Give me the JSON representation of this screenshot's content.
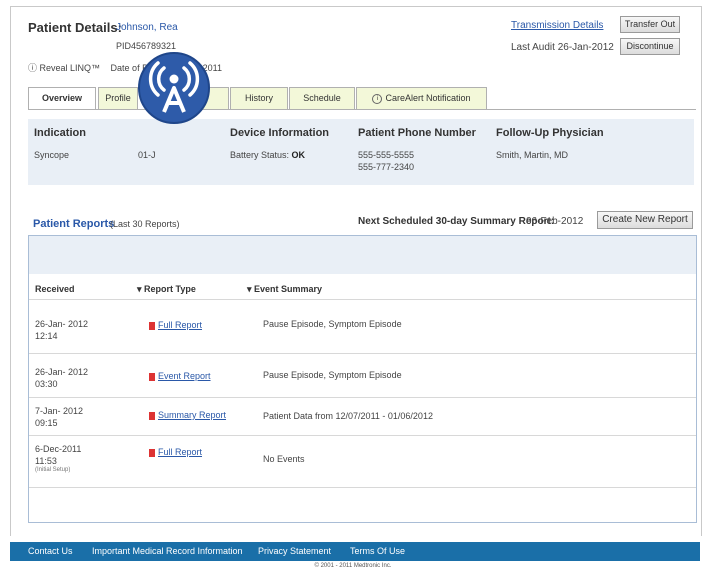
{
  "header": {
    "label": "Patient Details:",
    "patient_name": "Johnson, Rea",
    "patient_id": "PID456789321",
    "device": "ⓘ Reveal LINQ™",
    "dob_label": "Date of B",
    "dob_value": "2011",
    "transmission_link": "Transmission Details",
    "last_audit": "Last Audit  26-Jan-2012",
    "transfer_btn": "Transfer Out",
    "discontinue_btn": "Discontinue"
  },
  "tabs": [
    {
      "label": "Overview"
    },
    {
      "label": "Profile"
    },
    {
      "label": ""
    },
    {
      "label": "History"
    },
    {
      "label": "Schedule"
    },
    {
      "label": "CareAlert Notification"
    }
  ],
  "info": {
    "indication_head": "Indication",
    "indication_val": "Syncope",
    "date_val": "01-J",
    "device_head": "Device Information",
    "battery_label": "Battery Status:",
    "battery_val": "OK",
    "phone_head": "Patient Phone Number",
    "phone1": "555-555-5555",
    "phone2": "555-777-2340",
    "physician_head": "Follow-Up Physician",
    "physician_val": "Smith, Martin, MD"
  },
  "badge": {
    "icon": "broadcast-a-icon",
    "color": "#2e5ba9"
  },
  "reports": {
    "title": "Patient Reports",
    "subtitle": "(Last 30 Reports)",
    "next_label": "Next Scheduled 30-day Summary Report:",
    "next_value": "06-Feb-2012",
    "create_btn": "Create New Report",
    "columns": [
      "Received",
      "Report Type",
      "Event Summary"
    ],
    "rows": [
      {
        "date": "26-Jan- 2012",
        "time": "12:14",
        "type": "Full Report",
        "summary": "Pause Episode, Symptom Episode",
        "note": ""
      },
      {
        "date": "26-Jan- 2012",
        "time": "03:30",
        "type": "Event Report",
        "summary": "Pause Episode, Symptom Episode",
        "note": ""
      },
      {
        "date": "7-Jan- 2012",
        "time": "09:15",
        "type": "Summary Report",
        "summary": "Patient Data from 12/07/2011 - 01/06/2012",
        "note": ""
      },
      {
        "date": "6-Dec-2011",
        "time": "11:53",
        "type": "Full Report",
        "summary": "No Events",
        "note": "(Initial Setup)"
      }
    ]
  },
  "footer": {
    "links": [
      "Contact Us",
      "Important Medical Record Information",
      "Privacy Statement",
      "Terms Of Use"
    ],
    "copyright": "© 2001 - 2011 Medtronic Inc."
  }
}
